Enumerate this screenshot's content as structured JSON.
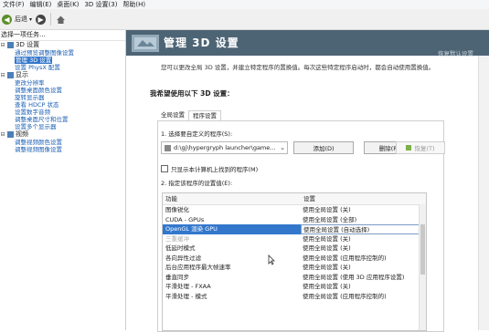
{
  "menu": [
    "文件(F)",
    "编辑(E)",
    "桌面(K)",
    "3D 设置(3)",
    "帮助(H)"
  ],
  "toolbar": {
    "back": "后退",
    "forward_icon": "forward-icon",
    "home_icon": "home-icon"
  },
  "left": {
    "title": "选择一项任务...",
    "categories": [
      {
        "name": "3D 设置",
        "items": [
          "通过预览调整图像设置",
          "管理 3D 设置",
          "设置 PhysX 配置"
        ]
      },
      {
        "name": "显示",
        "items": [
          "更改分辨率",
          "调整桌面颜色设置",
          "旋转显示器",
          "查看 HDCP 状态",
          "设置数字音频",
          "调整桌面尺寸和位置",
          "设置多个显示器"
        ]
      },
      {
        "name": "视频",
        "items": [
          "调整视频颜色设置",
          "调整视频图像设置"
        ]
      }
    ],
    "selected_item": "管理 3D 设置"
  },
  "main": {
    "title": "管理 3D 设置",
    "restore": "恢复默认设置",
    "description": "您可以更改全局 3D 设置，并建立特定程序的置换值。每次这些特定程序启动时，都会自动使用置换值。",
    "section_heading": "我希望使用以下 3D 设置：",
    "tabs": [
      "全局设置",
      "程序设置"
    ],
    "active_tab": "程序设置",
    "step1": "1. 选择要自定义的程序(S):",
    "program": "d:\\gj\\hypergryph launcher\\game...",
    "add": "添加(D)",
    "remove": "删除(R)",
    "restore_btn": "恢复(T)",
    "checkbox_label": "只显示本计算机上找到的程序(M)",
    "checkbox_checked": false,
    "step2": "2. 指定该程序的设置值(E):",
    "col_feature": "功能",
    "col_setting": "设置",
    "rows": [
      {
        "feature": "图像锐化",
        "setting": "使用全局设置 (关)"
      },
      {
        "feature": "CUDA - GPUs",
        "setting": "使用全局设置 (全部)"
      },
      {
        "feature": "OpenGL 渲染 GPU",
        "setting": "使用全局设置 (自动选择)",
        "selected": true
      },
      {
        "feature": "三重缓冲",
        "setting": "使用全局设置 (关)",
        "greyed": true
      },
      {
        "feature": "低延时模式",
        "setting": "使用全局设置 (关)"
      },
      {
        "feature": "各向异性过滤",
        "setting": "使用全局设置 (应用程序控制的)"
      },
      {
        "feature": "后台应用程序最大帧速率",
        "setting": "使用全局设置 (关)"
      },
      {
        "feature": "垂直同步",
        "setting": "使用全局设置 (使用 3D 应用程序设置)"
      },
      {
        "feature": "平滑处理 - FXAA",
        "setting": "使用全局设置 (关)"
      },
      {
        "feature": "平滑处理 - 模式",
        "setting": "使用全局设置 (应用程序控制的)"
      }
    ]
  }
}
